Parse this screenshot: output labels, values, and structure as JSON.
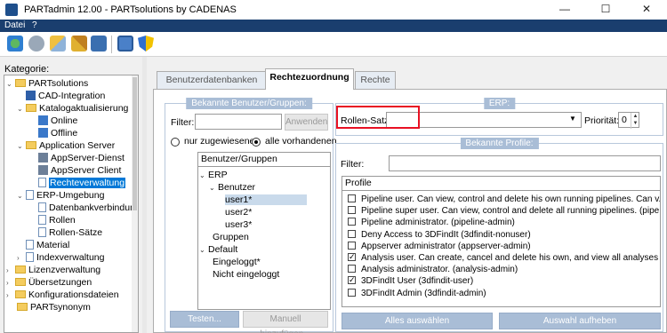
{
  "window": {
    "title": "PARTadmin 12.00 - PARTsolutions by CADENAS",
    "minimize": "—",
    "maximize": "☐",
    "close": "✕"
  },
  "menu": {
    "file": "Datei",
    "help": "?"
  },
  "toolbar": {
    "icons": [
      "refresh-icon",
      "settings-icon",
      "key-user-icon",
      "keys-icon",
      "network-icon",
      "save-icon",
      "shield-icon"
    ]
  },
  "sidebar": {
    "label": "Kategorie:",
    "tree": {
      "root": "PARTsolutions",
      "cad": "CAD-Integration",
      "katalog": "Katalogaktualisierung",
      "online": "Online",
      "offline": "Offline",
      "appserver": "Application Server",
      "appdienst": "AppServer-Dienst",
      "appclient": "AppServer Client",
      "rechte": "Rechteverwaltung",
      "erp": "ERP-Umgebung",
      "dbverb": "Datenbankverbindung",
      "rollen": "Rollen",
      "rollensaetze": "Rollen-Sätze",
      "material": "Material",
      "index": "Indexverwaltung",
      "lizenz": "Lizenzverwaltung",
      "uebers": "Übersetzungen",
      "konfig": "Konfigurationsdateien",
      "synonym": "PARTsynonym"
    }
  },
  "tabs": {
    "benutzerdb": "Benutzerdatenbanken",
    "rechtezuordnung": "Rechtezuordnung",
    "rechte": "Rechte"
  },
  "users_group": {
    "title": "Bekannte Benutzer/Gruppen:",
    "filter_label": "Filter:",
    "filter_value": "",
    "apply": "Anwenden",
    "radio_assigned": "nur zugewiesene",
    "radio_all": "alle vorhandenen",
    "list_header": "Benutzer/Gruppen",
    "tree": {
      "erp": "ERP",
      "benutzer": "Benutzer",
      "user1": "user1*",
      "user2": "user2*",
      "user3": "user3*",
      "gruppen": "Gruppen",
      "default": "Default",
      "eingeloggt": "Eingeloggt*",
      "nicht": "Nicht eingeloggt"
    },
    "test_button": "Testen...",
    "manual_button": "Manuell hinzufügen..."
  },
  "erp": {
    "title": "ERP:",
    "rollensatz_label": "Rollen-Satz:",
    "rollensatz_value": "",
    "prioritaet_label": "Priorität:",
    "prioritaet_value": "0"
  },
  "profiles": {
    "title": "Bekannte Profile:",
    "filter_label": "Filter:",
    "filter_value": "",
    "list_header": "Profile",
    "items": [
      {
        "label": "Pipeline user. Can view, control and delete his own running pipelines. Can v...",
        "checked": false
      },
      {
        "label": "Pipeline super user. Can view, control and delete all running pipelines. (pipe...",
        "checked": false
      },
      {
        "label": "Pipeline administrator. (pipeline-admin)",
        "checked": false
      },
      {
        "label": "Deny Access to 3DFindIt (3dfindit-nonuser)",
        "checked": false
      },
      {
        "label": "Appserver administrator (appserver-admin)",
        "checked": false
      },
      {
        "label": "Analysis user. Can create, cancel and delete his own, and view all analyses (a...",
        "checked": true
      },
      {
        "label": "Analysis administrator. (analysis-admin)",
        "checked": false
      },
      {
        "label": "3DFindIt User (3dfindit-user)",
        "checked": true
      },
      {
        "label": "3DFindIt Admin (3dfindit-admin)",
        "checked": false
      }
    ],
    "select_all": "Alles auswählen",
    "deselect": "Auswahl aufheben"
  }
}
